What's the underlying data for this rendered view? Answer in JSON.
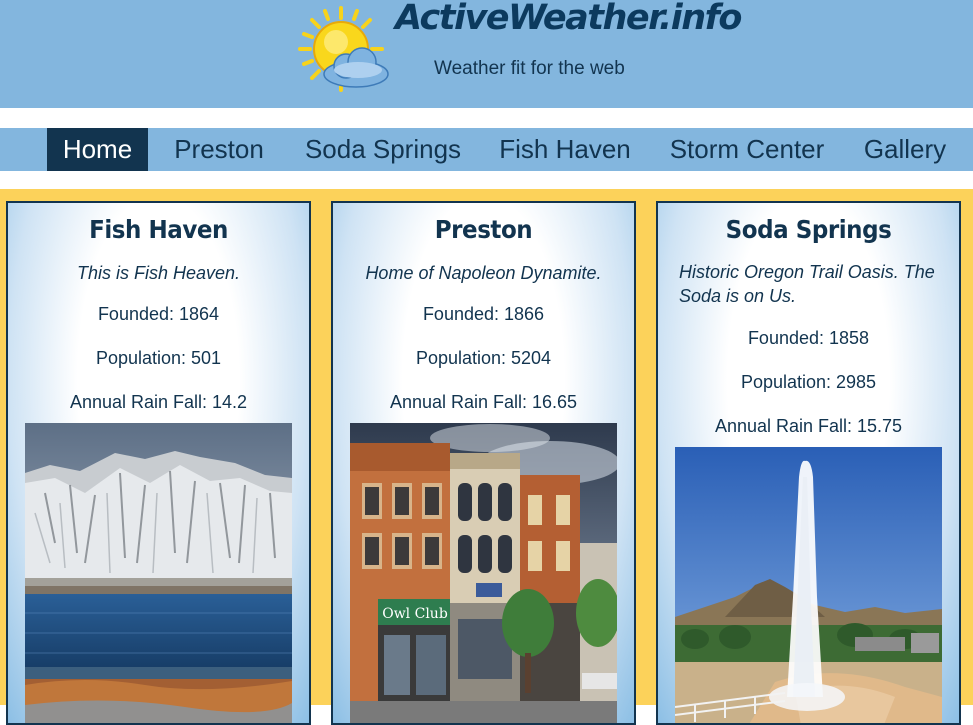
{
  "site": {
    "title": "ActiveWeather.info",
    "subtitle": "Weather fit for the web",
    "logo_icon": "sun-behind-cloud-icon"
  },
  "nav": {
    "items": [
      {
        "label": "Home",
        "active": true
      },
      {
        "label": "Preston",
        "active": false
      },
      {
        "label": "Soda Springs",
        "active": false
      },
      {
        "label": "Fish Haven",
        "active": false
      },
      {
        "label": "Storm Center",
        "active": false
      },
      {
        "label": "Gallery",
        "active": false
      }
    ]
  },
  "towns": [
    {
      "name": "Fish Haven",
      "tagline": "This is Fish Heaven.",
      "founded": "Founded: 1864",
      "population": "Population: 501",
      "rainfall": "Annual Rain Fall: 14.2",
      "photo": "snowy-mountains-lake-photo"
    },
    {
      "name": "Preston",
      "tagline": "Home of Napoleon Dynamite.",
      "founded": "Founded: 1866",
      "population": "Population: 5204",
      "rainfall": "Annual Rain Fall: 16.65",
      "photo": "main-street-buildings-photo",
      "sign_text": "Owl Club"
    },
    {
      "name": "Soda Springs",
      "tagline": "Historic Oregon Trail Oasis. The Soda is on Us.",
      "founded": "Founded: 1858",
      "population": "Population: 2985",
      "rainfall": "Annual Rain Fall: 15.75",
      "photo": "geyser-fountain-photo"
    }
  ],
  "colors": {
    "header_bg": "#83b6de",
    "nav_active_bg": "#12344f",
    "text_dark": "#12344f",
    "main_bg": "#fcd25a"
  }
}
